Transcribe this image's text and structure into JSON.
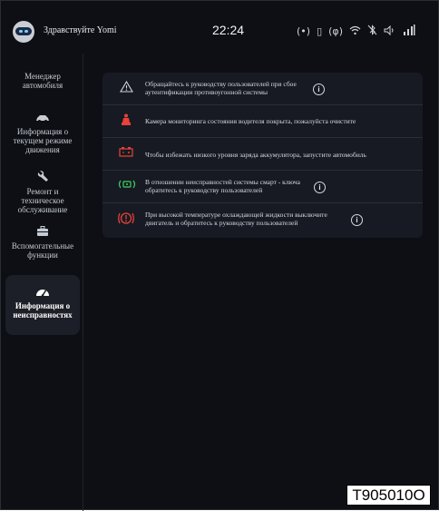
{
  "header": {
    "greeting": "Здравствуйте Yomi",
    "time": "22:24",
    "status_icons": [
      "(•)",
      "▯",
      "(φ)",
      "wifi",
      "bluetooth",
      "volume",
      "signal"
    ]
  },
  "sidebar": {
    "items": [
      {
        "label": "Менеджер автомобиля",
        "icon": ""
      },
      {
        "label": "Информация о текущем режиме движения",
        "icon": "car-icon"
      },
      {
        "label": "Ремонт и техническое обслуживание",
        "icon": "wrench-icon"
      },
      {
        "label": "Вспомогательные функции",
        "icon": "toolbox-icon"
      },
      {
        "label": "Информация о неисправностях",
        "icon": "gauge-icon",
        "active": true
      }
    ]
  },
  "alerts": [
    {
      "icon": "warning-triangle-icon",
      "text": "Обращайтесь к руководству пользователей при сбое аутентификации противоугонной системы",
      "has_info": true
    },
    {
      "icon": "driver-seat-icon",
      "text": "Камера мониторинга состояния водителя покрыта, пожалуйста очистите",
      "has_info": false
    },
    {
      "icon": "battery-icon",
      "text": "Чтобы избежать низкого уровня заряда аккумулятора, запустите автомобиль",
      "has_info": false
    },
    {
      "icon": "smart-key-icon",
      "text": "В отношении неисправностей системы смарт - ключа обратитесь к руководству пользователей",
      "has_info": true
    },
    {
      "icon": "coolant-temperature-icon",
      "text": "При высокой температуре охлаждающей жидкости выключите двигатель и обратитесь к руководству пользователей",
      "has_info": true
    }
  ],
  "info_glyph": "i",
  "figure_code": "T905010O",
  "colors": {
    "background": "#0d0f14",
    "panel": "#171a22",
    "alert_red": "#e8423a",
    "key_green": "#3fd15f"
  }
}
